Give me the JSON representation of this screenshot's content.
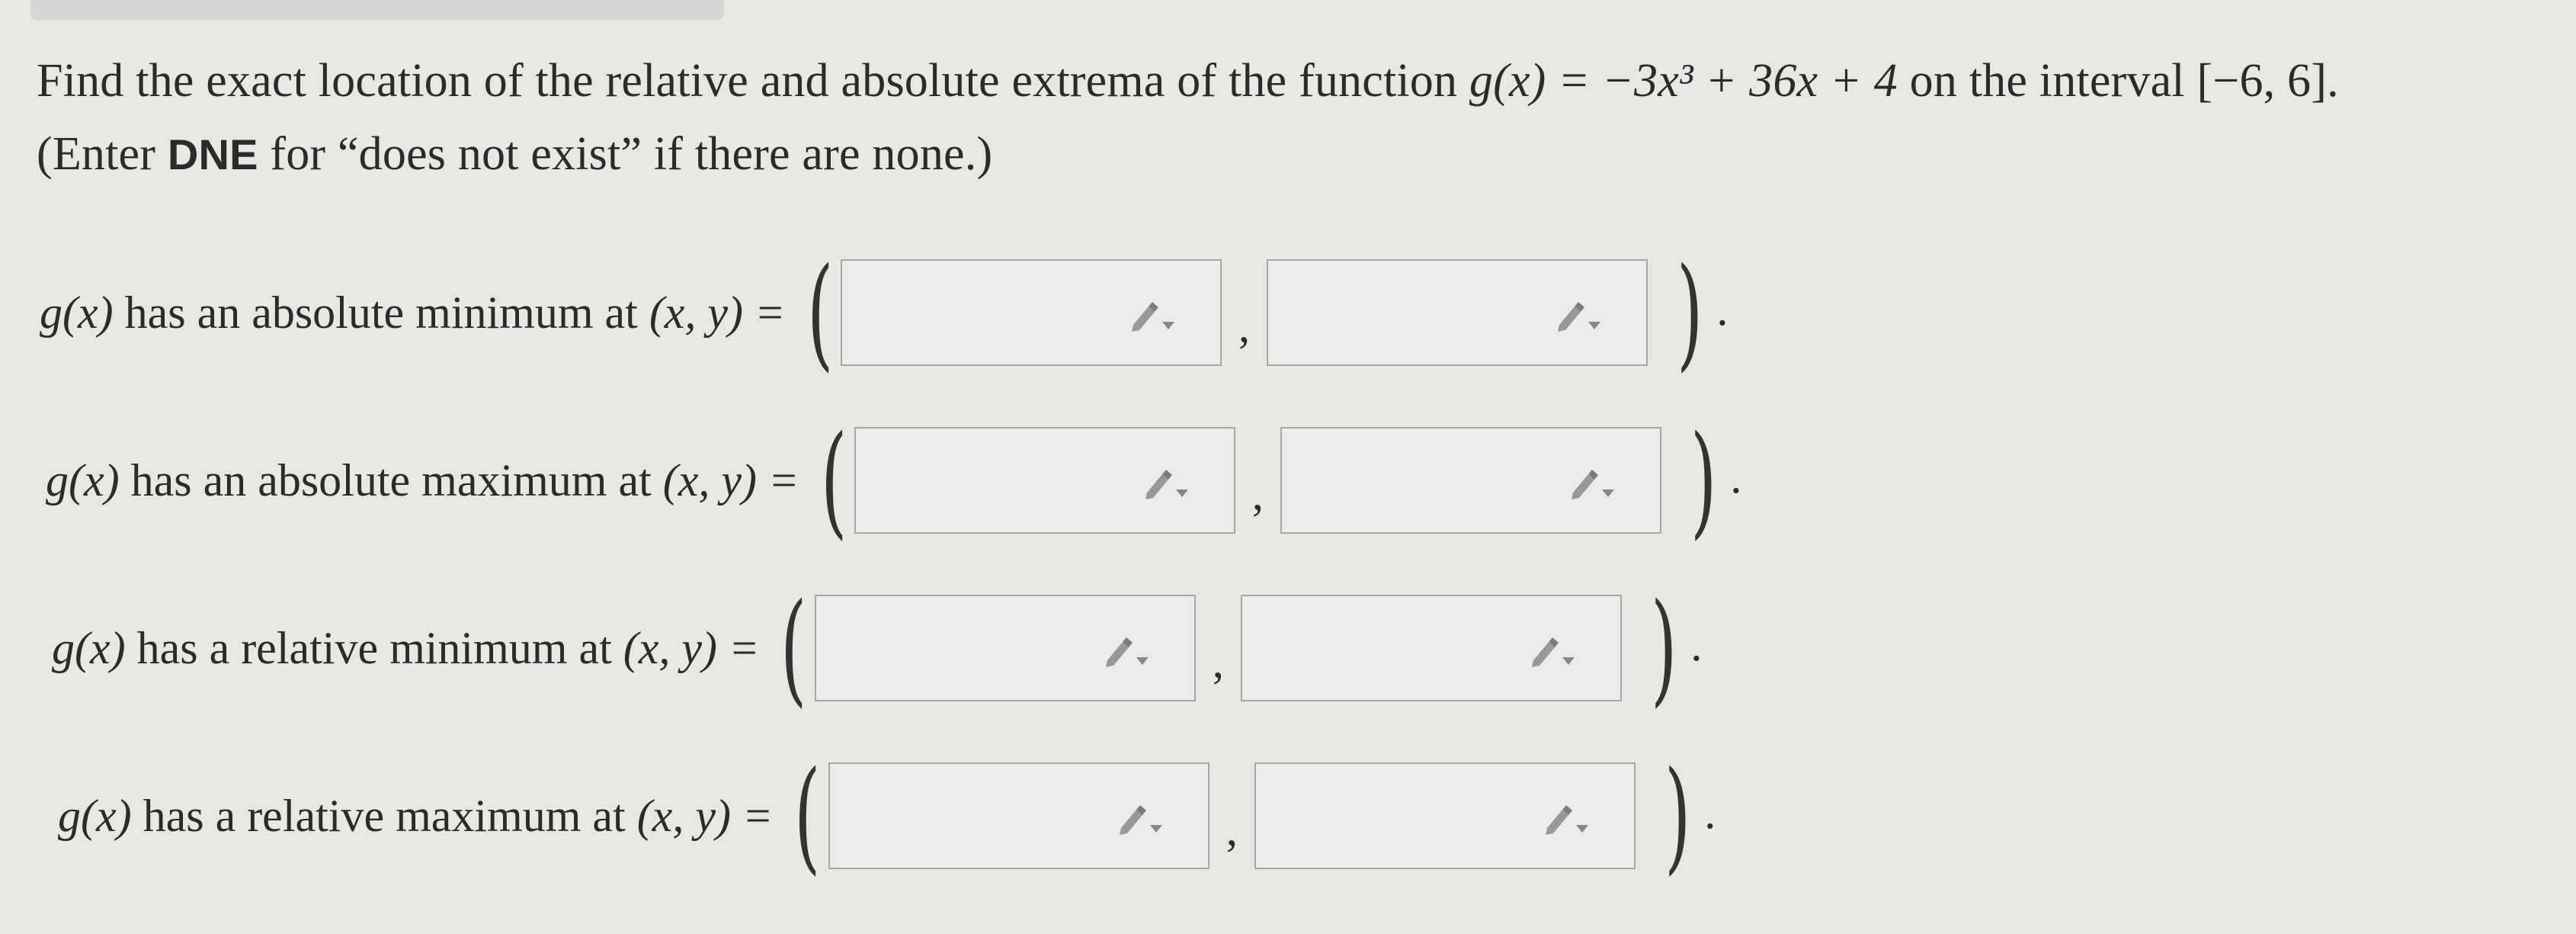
{
  "prompt": {
    "line1_start": "Find the exact location of the relative and absolute extrema of the function ",
    "function": "g(x) = −3x³ + 36x + 4",
    "line1_mid": " on the interval ",
    "interval": "[−6, 6]",
    "line1_end": ".",
    "line2_open": "(Enter ",
    "dne": "DNE",
    "line2_rest": " for “does not exist” if there are none.)"
  },
  "rows": [
    {
      "label_func": "g(x)",
      "label_text": " has an absolute minimum at ",
      "label_vars": "(x, y) =",
      "x_value": "",
      "y_value": ""
    },
    {
      "label_func": "g(x)",
      "label_text": " has an absolute maximum at ",
      "label_vars": "(x, y) =",
      "x_value": "",
      "y_value": ""
    },
    {
      "label_func": "g(x)",
      "label_text": " has a relative minimum at ",
      "label_vars": "(x, y) =",
      "x_value": "",
      "y_value": ""
    },
    {
      "label_func": "g(x)",
      "label_text": " has a relative maximum at ",
      "label_vars": "(x, y) =",
      "x_value": "",
      "y_value": ""
    }
  ],
  "punctuation": {
    "open": "(",
    "close": ")",
    "comma": ",",
    "period": "."
  },
  "icons": {
    "edit": "pencil-dropdown-icon"
  },
  "colors": {
    "background": "#e9e7e4",
    "box_border": "#a9a7a4",
    "text": "#2b2b2b"
  }
}
